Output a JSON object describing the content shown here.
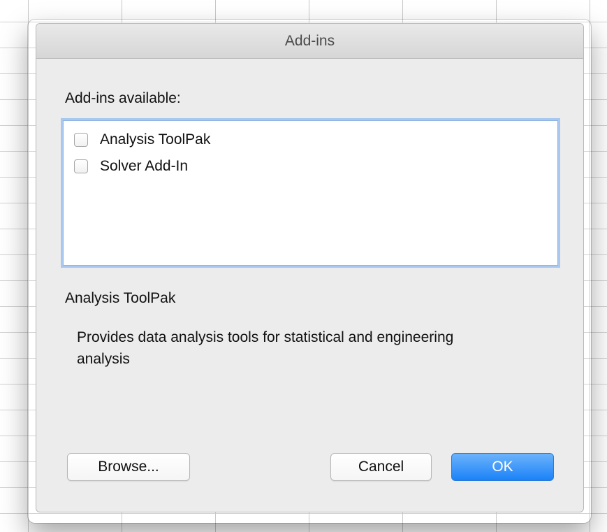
{
  "dialog": {
    "title": "Add-ins"
  },
  "addins": {
    "label": "Add-ins available:",
    "items": [
      {
        "label": "Analysis ToolPak",
        "checked": false
      },
      {
        "label": "Solver Add-In",
        "checked": false
      }
    ]
  },
  "description": {
    "title": "Analysis ToolPak",
    "text": "Provides data analysis tools for statistical and engineering analysis"
  },
  "buttons": {
    "browse": "Browse...",
    "cancel": "Cancel",
    "ok": "OK"
  },
  "colors": {
    "primary_button": "#1a82f7",
    "focus_ring": "#a9c8ef",
    "dialog_bg": "#ececec"
  }
}
